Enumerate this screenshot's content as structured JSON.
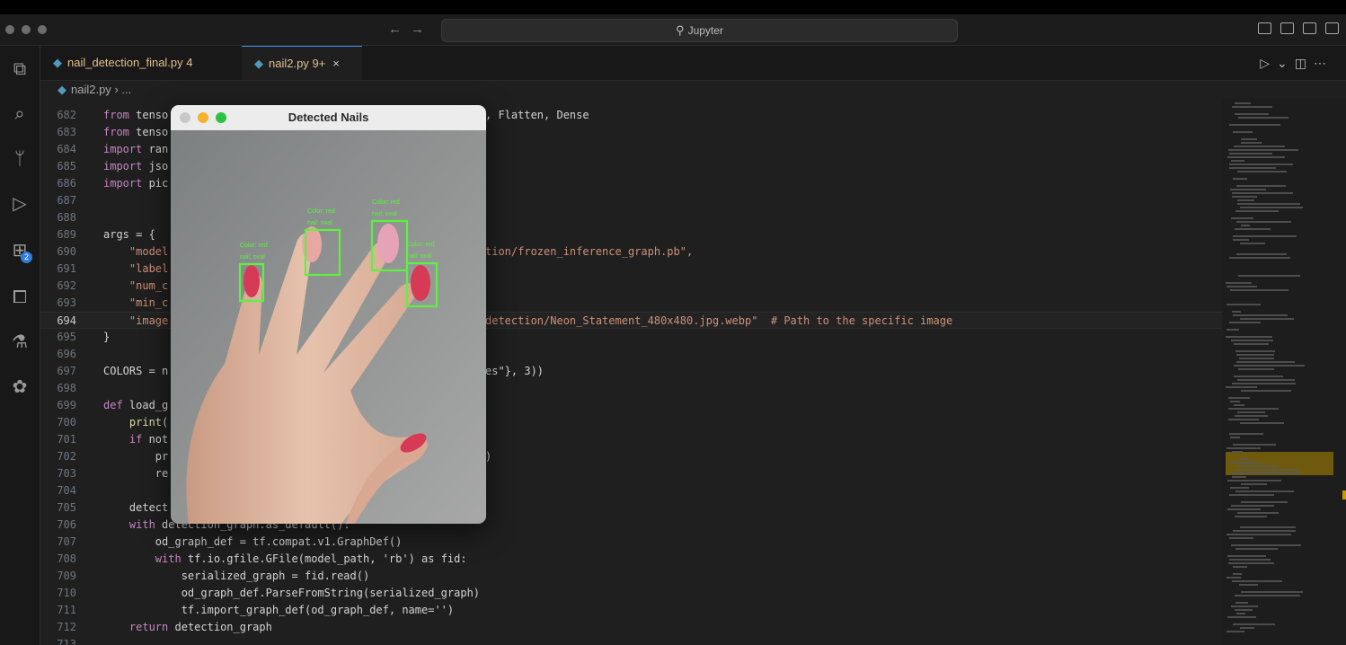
{
  "window": {
    "search_text": "Jupyter"
  },
  "activity_bar": [
    {
      "name": "explorer-icon",
      "glyph": "⧉"
    },
    {
      "name": "search-icon",
      "glyph": "⌕"
    },
    {
      "name": "source-control-icon",
      "glyph": "ᛘ"
    },
    {
      "name": "run-debug-icon",
      "glyph": "▷"
    },
    {
      "name": "extensions-icon",
      "glyph": "⊞",
      "badge": "2"
    },
    {
      "name": "remote-explorer-icon",
      "glyph": "⧠"
    },
    {
      "name": "testing-icon",
      "glyph": "⚗"
    },
    {
      "name": "python-icon",
      "glyph": "✿"
    }
  ],
  "tabs": [
    {
      "label": "nail_detection_final.py",
      "badge": "4"
    },
    {
      "label": "nail2.py",
      "badge": "9+",
      "close": "×"
    }
  ],
  "breadcrumb": {
    "file": "nail2.py",
    "sep": "›",
    "rest": "..."
  },
  "editor": {
    "current_line": "694",
    "lines": [
      {
        "n": "682",
        "t": "from tenso",
        "t2": ", Flatten, Dense"
      },
      {
        "n": "683",
        "t": "from tenso"
      },
      {
        "n": "684",
        "t": "import ran"
      },
      {
        "n": "685",
        "t": "import jso"
      },
      {
        "n": "686",
        "t": "import pic"
      },
      {
        "n": "687",
        "t": ""
      },
      {
        "n": "688",
        "t": ""
      },
      {
        "n": "689",
        "t": "args = {"
      },
      {
        "n": "690",
        "t": "    \"model",
        "t2": "tion/frozen_inference_graph.pb\","
      },
      {
        "n": "691",
        "t": "    \"label"
      },
      {
        "n": "692",
        "t": "    \"num_c"
      },
      {
        "n": "693",
        "t": "    \"min_c"
      },
      {
        "n": "694",
        "t": "    \"image",
        "t2": "detection/Neon_Statement_480x480.jpg.webp\"  # Path to the specific image"
      },
      {
        "n": "695",
        "t": "}"
      },
      {
        "n": "696",
        "t": ""
      },
      {
        "n": "697",
        "t": "COLORS = n",
        "t2": "es\"}, 3))"
      },
      {
        "n": "698",
        "t": ""
      },
      {
        "n": "699",
        "t": "def load_g"
      },
      {
        "n": "700",
        "t": "    print("
      },
      {
        "n": "701",
        "t": "    if not"
      },
      {
        "n": "702",
        "t": "        pr",
        "t2": ")"
      },
      {
        "n": "703",
        "t": "        re"
      },
      {
        "n": "704",
        "t": ""
      },
      {
        "n": "705",
        "t": "    detect"
      },
      {
        "n": "706",
        "t": "    with detection_graph.as_default():"
      },
      {
        "n": "707",
        "t": "        od_graph_def = tf.compat.v1.GraphDef()"
      },
      {
        "n": "708",
        "t": "        with tf.io.gfile.GFile(model_path, 'rb') as fid:"
      },
      {
        "n": "709",
        "t": "            serialized_graph = fid.read()"
      },
      {
        "n": "710",
        "t": "            od_graph_def.ParseFromString(serialized_graph)"
      },
      {
        "n": "711",
        "t": "            tf.import_graph_def(od_graph_def, name='')"
      },
      {
        "n": "712",
        "t": "    return detection_graph"
      },
      {
        "n": "713",
        "t": ""
      }
    ]
  },
  "popup": {
    "title": "Detected Nails",
    "detections": [
      {
        "color": "Color: red",
        "shape": "nail: oval"
      },
      {
        "color": "Color: red",
        "shape": "nail: oval"
      },
      {
        "color": "Color: red",
        "shape": "nail: oval"
      },
      {
        "color": "Color: red",
        "shape": "nail: oval"
      }
    ]
  },
  "colors": {
    "accent": "#3b8eea",
    "bbox": "#5cf23d",
    "keyword": "#c586c0",
    "function": "#dcdcaa",
    "string": "#ce9178",
    "comment": "#6a9955",
    "variable": "#9cdcfe",
    "nail": "#d63a55"
  }
}
